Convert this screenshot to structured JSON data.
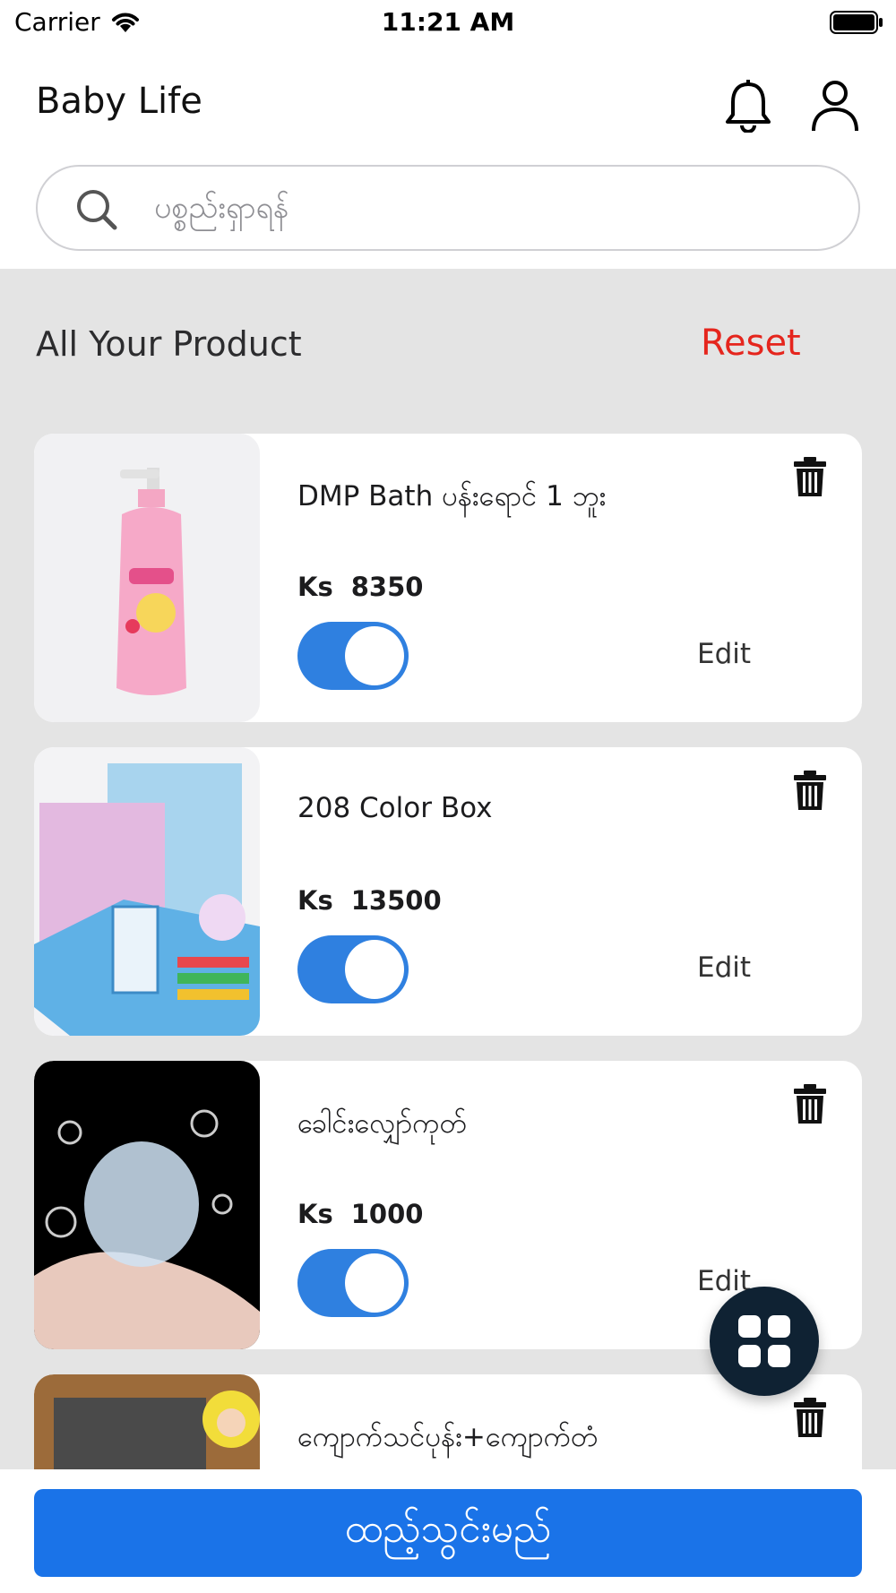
{
  "status_bar": {
    "carrier": "Carrier",
    "time": "11:21 AM"
  },
  "header": {
    "title": "Baby Life",
    "search": {
      "placeholder": "ပစ္စည်းရှာရန်"
    }
  },
  "section": {
    "title": "All Your Product",
    "reset_label": "Reset"
  },
  "products": [
    {
      "name": "DMP Bath ပန်းရောင် 1 ဘူး",
      "currency": "Ks",
      "price": "8350",
      "enabled": true,
      "edit_label": "Edit"
    },
    {
      "name": "208 Color Box",
      "currency": "Ks",
      "price": "13500",
      "enabled": true,
      "edit_label": "Edit"
    },
    {
      "name": "ခေါင်းလျှော်ကုတ်",
      "currency": "Ks",
      "price": "1000",
      "enabled": true,
      "edit_label": "Edit"
    },
    {
      "name": "ကျောက်သင်ပုန်း+ကျောက်တံ"
    }
  ],
  "bottom": {
    "add_label": "ထည့်သွင်းမည်"
  },
  "colors": {
    "accent": "#1a73e8",
    "toggle_on": "#2f80e0",
    "reset": "#e5251d",
    "fab": "#0f2233",
    "content_bg": "#e4e4e4"
  },
  "icons": [
    "wifi-icon",
    "battery-icon",
    "bell-icon",
    "user-icon",
    "search-icon",
    "trash-icon",
    "grid-icon"
  ]
}
